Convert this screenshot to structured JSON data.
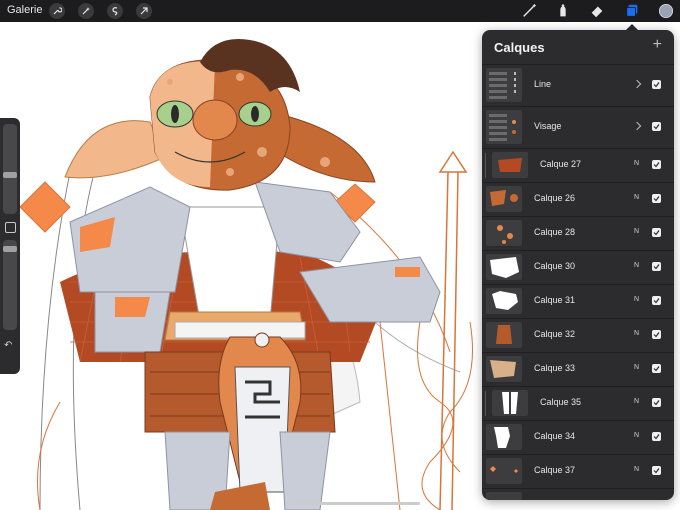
{
  "toolbar": {
    "gallery_label": "Galerie",
    "left_tools": [
      "wrench-icon",
      "magic-wand-icon",
      "selection-icon",
      "transform-arrow-icon"
    ],
    "right_tools": [
      "brush-icon",
      "smudge-icon",
      "eraser-icon",
      "layers-icon",
      "color-swatch"
    ],
    "active_color": "#9aa3b5",
    "accent_color": "#1a6cf0"
  },
  "layers_panel": {
    "title": "Calques",
    "add_label": "+",
    "layers": [
      {
        "name": "Line",
        "type": "group",
        "visible": true
      },
      {
        "name": "Visage",
        "type": "group",
        "visible": true
      },
      {
        "name": "Calque 27",
        "blend": "N",
        "visible": true
      },
      {
        "name": "Calque 26",
        "blend": "N",
        "visible": true
      },
      {
        "name": "Calque 28",
        "blend": "N",
        "visible": true
      },
      {
        "name": "Calque 30",
        "blend": "N",
        "visible": true
      },
      {
        "name": "Calque 31",
        "blend": "N",
        "visible": true
      },
      {
        "name": "Calque 32",
        "blend": "N",
        "visible": true
      },
      {
        "name": "Calque 33",
        "blend": "N",
        "visible": true
      },
      {
        "name": "Calque 35",
        "blend": "N",
        "visible": true
      },
      {
        "name": "Calque 34",
        "blend": "N",
        "visible": true
      },
      {
        "name": "Calque 37",
        "blend": "N",
        "visible": true
      }
    ]
  },
  "sidebar": {
    "brush_size_level": 0.45,
    "opacity_level": 0.9,
    "undo_icon": "undo-icon"
  }
}
